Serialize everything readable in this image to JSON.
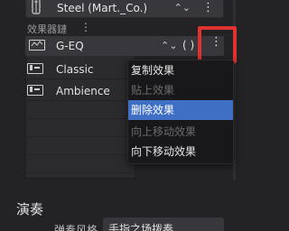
{
  "top_row": {
    "preset_name": "Steel (Mart._Co.)",
    "icon": "guitar-icon",
    "chevron": "⌃⌄",
    "more": "⋮"
  },
  "effects_chain": {
    "label": "效果器鏈",
    "more": "⋮",
    "items": [
      {
        "name": "G-EQ",
        "icon": "eq-icon",
        "chevron": "⌃⌄",
        "power": "( )",
        "more": "⋮"
      },
      {
        "name": "Classic",
        "icon": "amp-icon"
      },
      {
        "name": "Ambience",
        "icon": "amp-icon"
      }
    ]
  },
  "context_menu": {
    "items": [
      {
        "label": "复制效果",
        "state": "enabled"
      },
      {
        "label": "贴上效果",
        "state": "disabled"
      },
      {
        "label": "删除效果",
        "state": "active"
      },
      {
        "label": "向上移动效果",
        "state": "disabled"
      },
      {
        "label": "向下移动效果",
        "state": "enabled"
      }
    ]
  },
  "performance": {
    "title": "演奏",
    "style_label": "弹奏风格",
    "style_value": "手指之场拨奏"
  },
  "colors": {
    "highlight": "#e0322e",
    "menu_active": "#3f6fc4"
  }
}
